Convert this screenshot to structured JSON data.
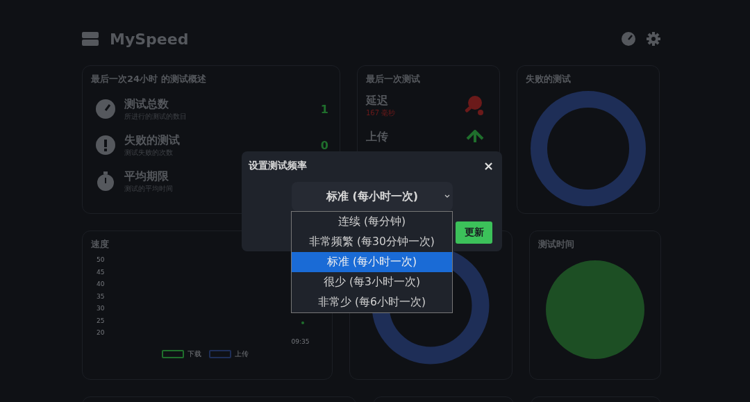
{
  "header": {
    "title": "MySpeed"
  },
  "summary": {
    "title": "最后一次24小时 的测试概述",
    "stats": [
      {
        "kind": "gauge",
        "label": "测试总数",
        "sub": "所进行的测试的数目",
        "value": "1"
      },
      {
        "kind": "alert",
        "label": "失败的测试",
        "sub": "测试失败的次数",
        "value": "0"
      },
      {
        "kind": "timer",
        "label": "平均期限",
        "sub": "测试的平均时间"
      }
    ]
  },
  "latest": {
    "title": "最后一次测试",
    "items": [
      {
        "kind": "ping",
        "label": "延迟",
        "reading": "167 毫秒"
      },
      {
        "kind": "upload",
        "label": "上传"
      }
    ]
  },
  "failed": {
    "title": "失败的测试"
  },
  "speed": {
    "title": "速度",
    "yticks": [
      "50",
      "45",
      "40",
      "35",
      "30",
      "25",
      "20"
    ],
    "xlabel": "09:35",
    "legend": [
      {
        "name": "下载",
        "color": "#1f6e2c"
      },
      {
        "name": "上传",
        "color": "#1e2e57"
      }
    ]
  },
  "test_time": {
    "title": "测试时间"
  },
  "dialog": {
    "title": "设置测试频率",
    "close": "×",
    "select_value": "标准 (每小时一次)",
    "options": [
      {
        "label": "连续 (每分钟)",
        "selected": false
      },
      {
        "label": "非常频繁 (每30分钟一次)",
        "selected": false
      },
      {
        "label": "标准 (每小时一次)",
        "selected": true
      },
      {
        "label": "很少 (每3小时一次)",
        "selected": false
      },
      {
        "label": "非常少 (每6小时一次)",
        "selected": false
      }
    ],
    "button": "更新"
  }
}
